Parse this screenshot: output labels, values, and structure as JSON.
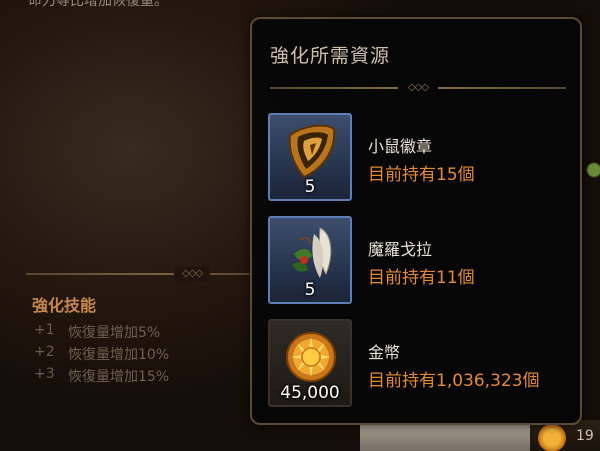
{
  "background": {
    "top_text": "命力等比增加恢復量。",
    "skill_section": {
      "title": "強化技能",
      "rows": [
        {
          "level": "+1",
          "desc": "恢復量增加5%"
        },
        {
          "level": "+2",
          "desc": "恢復量增加10%"
        },
        {
          "level": "+3",
          "desc": "恢復量增加15%"
        }
      ]
    },
    "bottom_right_value": "19"
  },
  "popup": {
    "title": "強化所需資源",
    "items": [
      {
        "name": "小鼠徽章",
        "owned": "目前持有15個",
        "quantity": "5",
        "icon": "mouse-badge-icon",
        "frame": "blue"
      },
      {
        "name": "魔羅戈拉",
        "owned": "目前持有11個",
        "quantity": "5",
        "icon": "feather-herb-icon",
        "frame": "blue"
      },
      {
        "name": "金幣",
        "owned": "目前持有1,036,323個",
        "quantity": "45,000",
        "icon": "gold-coin-icon",
        "frame": "plain"
      }
    ]
  },
  "colors": {
    "accent_orange": "#e58a2e",
    "skill_title": "#c7884a",
    "frame_blue": "#5d7fb5",
    "popup_border": "#5c4a33"
  }
}
